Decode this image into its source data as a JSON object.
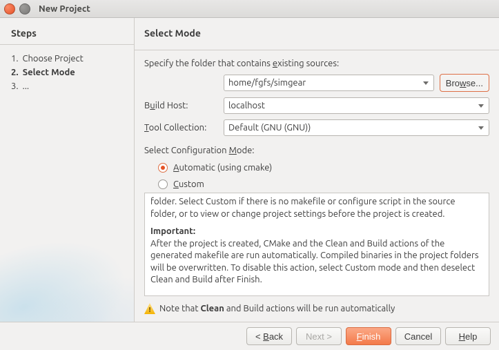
{
  "window": {
    "title": "New Project"
  },
  "steps": {
    "heading": "Steps",
    "items": [
      {
        "num": "1.",
        "label": "Choose Project"
      },
      {
        "num": "2.",
        "label": "Select Mode"
      },
      {
        "num": "3.",
        "label": "..."
      }
    ],
    "active_index": 1
  },
  "panel": {
    "title": "Select Mode",
    "folder_prompt_pre": "Specify the folder that contains ",
    "folder_prompt_ukey": "e",
    "folder_prompt_post": "xisting sources:",
    "folder_value": "home/fgfs/simgear",
    "browse_pre": "Bro",
    "browse_ukey": "w",
    "browse_post": "se...",
    "build_host_label_pre": "B",
    "build_host_label_ukey": "u",
    "build_host_label_post": "ild Host:",
    "build_host_value": "localhost",
    "tool_label_ukey": "T",
    "tool_label_post": "ool Collection:",
    "tool_value": "Default (GNU (GNU))",
    "config_label_pre": "Select Configuration ",
    "config_label_ukey": "M",
    "config_label_post": "ode:",
    "radio_auto_ukey": "A",
    "radio_auto_post": "utomatic (using cmake)",
    "radio_custom_ukey": "C",
    "radio_custom_post": "ustom",
    "info_p1": "folder. Select Custom if there is no makefile or configure script in the source folder, or to view or change project settings before the project is created.",
    "info_important": "Important:",
    "info_p2": "After the project is created, CMake and the Clean and Build actions of the generated makefile are run automatically. Compiled binaries in the project folders will be overwritten. To disable this action, select Custom mode and then deselect Clean and Build after Finish.",
    "note_pre": "Note that ",
    "note_bold": "Clean",
    "note_post": " and Build actions will be run automatically",
    "warn_glyph": "!"
  },
  "buttons": {
    "back_pre": "< ",
    "back_ukey": "B",
    "back_post": "ack",
    "next": "Next >",
    "finish_ukey": "F",
    "finish_post": "inish",
    "cancel": "Cancel",
    "help_ukey": "H",
    "help_post": "elp"
  }
}
